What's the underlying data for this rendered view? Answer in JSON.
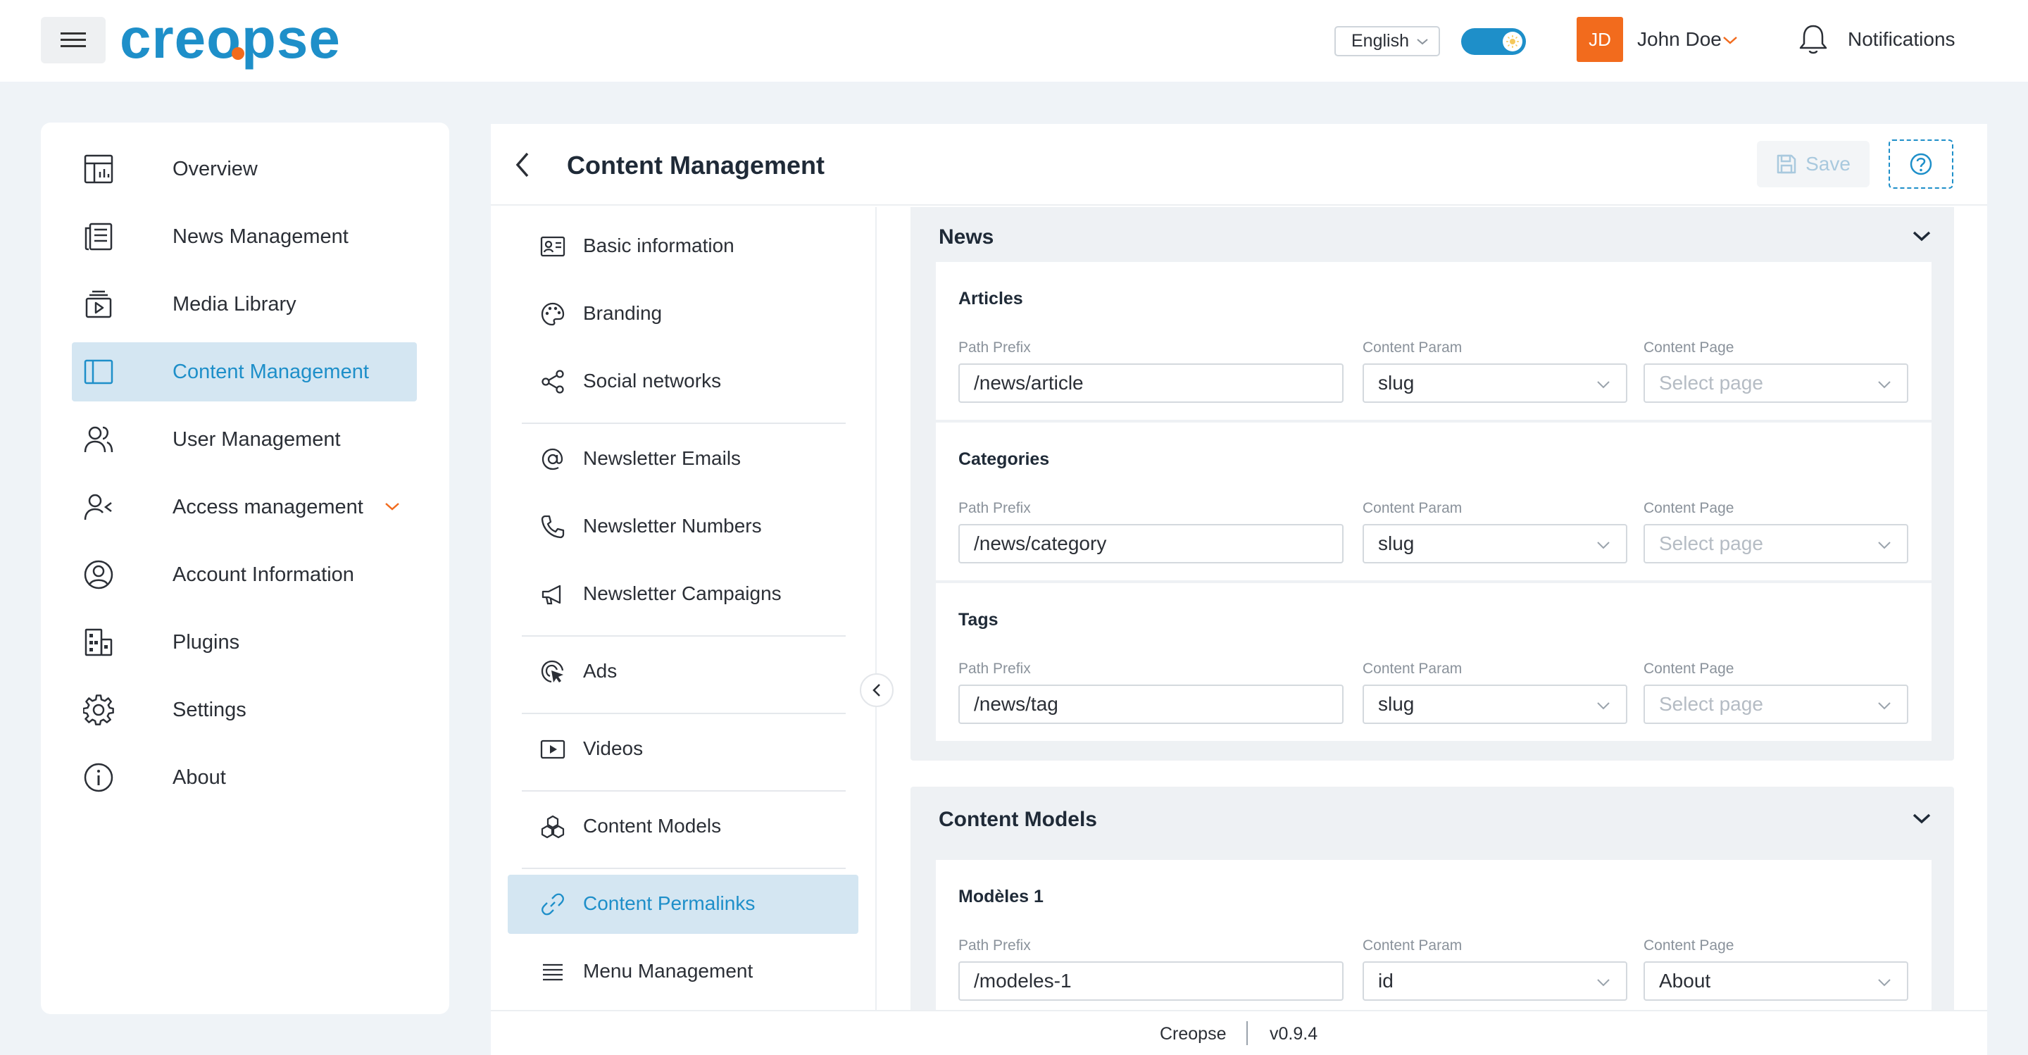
{
  "header": {
    "logo_text": "creopse",
    "language": "English",
    "user": {
      "initials": "JD",
      "name": "John Doe"
    },
    "notifications_label": "Notifications"
  },
  "sidebar": {
    "items": [
      {
        "label": "Overview",
        "icon": "overview-icon"
      },
      {
        "label": "News Management",
        "icon": "newspaper-icon"
      },
      {
        "label": "Media Library",
        "icon": "media-library-icon"
      },
      {
        "label": "Content Management",
        "icon": "layout-icon",
        "active": true
      },
      {
        "label": "User Management",
        "icon": "users-icon"
      },
      {
        "label": "Access management",
        "icon": "user-access-icon",
        "expandable": true
      },
      {
        "label": "Account Information",
        "icon": "account-circle-icon"
      },
      {
        "label": "Plugins",
        "icon": "plugins-icon"
      },
      {
        "label": "Settings",
        "icon": "gear-icon"
      },
      {
        "label": "About",
        "icon": "info-icon"
      }
    ]
  },
  "page": {
    "title": "Content Management",
    "save_label": "Save"
  },
  "subnav": {
    "items": [
      {
        "label": "Basic information",
        "icon": "id-card-icon"
      },
      {
        "label": "Branding",
        "icon": "palette-icon"
      },
      {
        "label": "Social networks",
        "icon": "share-icon"
      },
      {
        "label": "Newsletter Emails",
        "icon": "at-sign-icon"
      },
      {
        "label": "Newsletter Numbers",
        "icon": "phone-icon"
      },
      {
        "label": "Newsletter Campaigns",
        "icon": "megaphone-icon"
      },
      {
        "label": "Ads",
        "icon": "target-cursor-icon"
      },
      {
        "label": "Videos",
        "icon": "video-icon"
      },
      {
        "label": "Content Models",
        "icon": "cubes-icon"
      },
      {
        "label": "Content Permalinks",
        "icon": "link-icon",
        "active": true
      },
      {
        "label": "Menu Management",
        "icon": "menu-lines-icon"
      }
    ]
  },
  "labels": {
    "path_prefix": "Path Prefix",
    "content_param": "Content Param",
    "content_page": "Content Page",
    "select_page": "Select page"
  },
  "sections": [
    {
      "title": "News",
      "cards": [
        {
          "title": "Articles",
          "path_prefix": "/news/article",
          "content_param": "slug",
          "content_page": ""
        },
        {
          "title": "Categories",
          "path_prefix": "/news/category",
          "content_param": "slug",
          "content_page": ""
        },
        {
          "title": "Tags",
          "path_prefix": "/news/tag",
          "content_param": "slug",
          "content_page": ""
        }
      ]
    },
    {
      "title": "Content Models",
      "cards": [
        {
          "title": "Modèles 1",
          "path_prefix": "/modeles-1",
          "content_param": "id",
          "content_page": "About"
        }
      ]
    }
  ],
  "footer": {
    "brand": "Creopse",
    "version": "v0.9.4"
  },
  "colors": {
    "accent": "#1e8fc9",
    "brand_orange": "#f26b1d",
    "active_bg": "#d4e6f2"
  }
}
